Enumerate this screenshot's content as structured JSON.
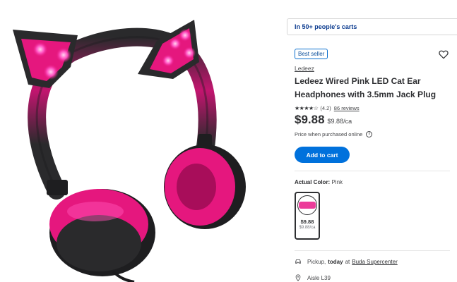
{
  "carts_banner": "In 50+ people's carts",
  "badge": "Best seller",
  "brand": "Ledeez",
  "title": "Ledeez Wired Pink LED Cat Ear Headphones with 3.5mm Jack Plug",
  "rating": {
    "stars": "★★★★☆",
    "value": "(4.2)",
    "reviews": "86 reviews",
    "score": 4.2
  },
  "price": {
    "current": "$9.88",
    "unit": "$9.88/ca",
    "note": "Price when purchased online"
  },
  "add_to_cart": "Add to cart",
  "color": {
    "label": "Actual Color:",
    "value": "Pink",
    "swatch_color": "#ec3c9a"
  },
  "swatch": {
    "price": "$9.88",
    "unit": "$9.88/ca"
  },
  "fulfillment": {
    "pickup_label": "Pickup,",
    "pickup_when": "today",
    "pickup_at": "at",
    "store": "Buda Supercenter",
    "aisle": "Aisle L39"
  },
  "colors": {
    "accent": "#0071dc",
    "banner_text": "#0b3b8f",
    "product_pink": "#e5177e",
    "product_black": "#2a2a2c"
  },
  "icons": {
    "favorite": "heart-icon",
    "info": "info-icon",
    "pickup": "car-icon",
    "location": "location-pin-icon"
  }
}
